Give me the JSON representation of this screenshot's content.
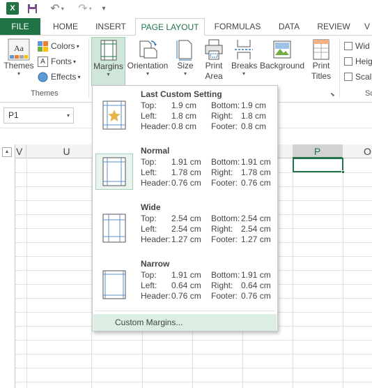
{
  "quick_access": {
    "app_icon": "X",
    "more": "▾"
  },
  "tabs": [
    {
      "label": "FILE"
    },
    {
      "label": "HOME"
    },
    {
      "label": "INSERT"
    },
    {
      "label": "PAGE LAYOUT"
    },
    {
      "label": "FORMULAS"
    },
    {
      "label": "DATA"
    },
    {
      "label": "REVIEW"
    },
    {
      "label": "V"
    }
  ],
  "ribbon": {
    "themes": {
      "themes_label": "Themes",
      "colors_label": "Colors",
      "fonts_label": "Fonts",
      "effects_label": "Effects",
      "group_label": "Themes",
      "thumb_text": "Aa"
    },
    "page_setup": {
      "margins_label": "Margins",
      "orientation_label": "Orientation",
      "size_label": "Size",
      "print_area_label_1": "Print",
      "print_area_label_2": "Area",
      "breaks_label": "Breaks",
      "background_label": "Background",
      "print_titles_label_1": "Print",
      "print_titles_label_2": "Titles"
    },
    "scale": {
      "width_label": "Wid",
      "height_label": "Heig",
      "scale_label": "Scal",
      "group_label": "Sc"
    }
  },
  "namebox": {
    "value": "P1"
  },
  "columns": [
    "V",
    "U",
    "P",
    "O"
  ],
  "margins_menu": {
    "options": [
      {
        "title": "Last Custom Setting",
        "top_label": "Top:",
        "top": "1.9 cm",
        "bottom_label": "Bottom:",
        "bottom": "1.9 cm",
        "left_label": "Left:",
        "left": "1.8 cm",
        "right_label": "Right:",
        "right": "1.8 cm",
        "header_label": "Header:",
        "header": "0.8 cm",
        "footer_label": "Footer:",
        "footer": "0.8 cm"
      },
      {
        "title": "Normal",
        "top_label": "Top:",
        "top": "1.91 cm",
        "bottom_label": "Bottom:",
        "bottom": "1.91 cm",
        "left_label": "Left:",
        "left": "1.78 cm",
        "right_label": "Right:",
        "right": "1.78 cm",
        "header_label": "Header:",
        "header": "0.76 cm",
        "footer_label": "Footer:",
        "footer": "0.76 cm"
      },
      {
        "title": "Wide",
        "top_label": "Top:",
        "top": "2.54 cm",
        "bottom_label": "Bottom:",
        "bottom": "2.54 cm",
        "left_label": "Left:",
        "left": "2.54 cm",
        "right_label": "Right:",
        "right": "2.54 cm",
        "header_label": "Header:",
        "header": "1.27 cm",
        "footer_label": "Footer:",
        "footer": "1.27 cm"
      },
      {
        "title": "Narrow",
        "top_label": "Top:",
        "top": "1.91 cm",
        "bottom_label": "Bottom:",
        "bottom": "1.91 cm",
        "left_label": "Left:",
        "left": "0.64 cm",
        "right_label": "Right:",
        "right": "0.64 cm",
        "header_label": "Header:",
        "header": "0.76 cm",
        "footer_label": "Footer:",
        "footer": "0.76 cm"
      }
    ],
    "custom_label": "Custom Margins..."
  },
  "colors": {
    "accent": "#217346",
    "selection_bg": "#cfe6d9",
    "hover_bg": "#dcede3"
  }
}
